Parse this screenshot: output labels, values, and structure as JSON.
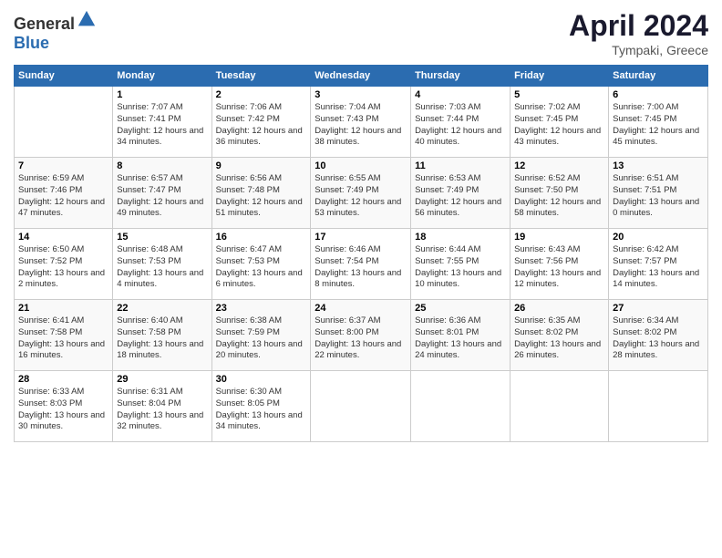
{
  "header": {
    "logo_general": "General",
    "logo_blue": "Blue",
    "title": "April 2024",
    "location": "Tympaki, Greece"
  },
  "columns": [
    "Sunday",
    "Monday",
    "Tuesday",
    "Wednesday",
    "Thursday",
    "Friday",
    "Saturday"
  ],
  "weeks": [
    [
      {
        "day": "",
        "sunrise": "",
        "sunset": "",
        "daylight": ""
      },
      {
        "day": "1",
        "sunrise": "Sunrise: 7:07 AM",
        "sunset": "Sunset: 7:41 PM",
        "daylight": "Daylight: 12 hours and 34 minutes."
      },
      {
        "day": "2",
        "sunrise": "Sunrise: 7:06 AM",
        "sunset": "Sunset: 7:42 PM",
        "daylight": "Daylight: 12 hours and 36 minutes."
      },
      {
        "day": "3",
        "sunrise": "Sunrise: 7:04 AM",
        "sunset": "Sunset: 7:43 PM",
        "daylight": "Daylight: 12 hours and 38 minutes."
      },
      {
        "day": "4",
        "sunrise": "Sunrise: 7:03 AM",
        "sunset": "Sunset: 7:44 PM",
        "daylight": "Daylight: 12 hours and 40 minutes."
      },
      {
        "day": "5",
        "sunrise": "Sunrise: 7:02 AM",
        "sunset": "Sunset: 7:45 PM",
        "daylight": "Daylight: 12 hours and 43 minutes."
      },
      {
        "day": "6",
        "sunrise": "Sunrise: 7:00 AM",
        "sunset": "Sunset: 7:45 PM",
        "daylight": "Daylight: 12 hours and 45 minutes."
      }
    ],
    [
      {
        "day": "7",
        "sunrise": "Sunrise: 6:59 AM",
        "sunset": "Sunset: 7:46 PM",
        "daylight": "Daylight: 12 hours and 47 minutes."
      },
      {
        "day": "8",
        "sunrise": "Sunrise: 6:57 AM",
        "sunset": "Sunset: 7:47 PM",
        "daylight": "Daylight: 12 hours and 49 minutes."
      },
      {
        "day": "9",
        "sunrise": "Sunrise: 6:56 AM",
        "sunset": "Sunset: 7:48 PM",
        "daylight": "Daylight: 12 hours and 51 minutes."
      },
      {
        "day": "10",
        "sunrise": "Sunrise: 6:55 AM",
        "sunset": "Sunset: 7:49 PM",
        "daylight": "Daylight: 12 hours and 53 minutes."
      },
      {
        "day": "11",
        "sunrise": "Sunrise: 6:53 AM",
        "sunset": "Sunset: 7:49 PM",
        "daylight": "Daylight: 12 hours and 56 minutes."
      },
      {
        "day": "12",
        "sunrise": "Sunrise: 6:52 AM",
        "sunset": "Sunset: 7:50 PM",
        "daylight": "Daylight: 12 hours and 58 minutes."
      },
      {
        "day": "13",
        "sunrise": "Sunrise: 6:51 AM",
        "sunset": "Sunset: 7:51 PM",
        "daylight": "Daylight: 13 hours and 0 minutes."
      }
    ],
    [
      {
        "day": "14",
        "sunrise": "Sunrise: 6:50 AM",
        "sunset": "Sunset: 7:52 PM",
        "daylight": "Daylight: 13 hours and 2 minutes."
      },
      {
        "day": "15",
        "sunrise": "Sunrise: 6:48 AM",
        "sunset": "Sunset: 7:53 PM",
        "daylight": "Daylight: 13 hours and 4 minutes."
      },
      {
        "day": "16",
        "sunrise": "Sunrise: 6:47 AM",
        "sunset": "Sunset: 7:53 PM",
        "daylight": "Daylight: 13 hours and 6 minutes."
      },
      {
        "day": "17",
        "sunrise": "Sunrise: 6:46 AM",
        "sunset": "Sunset: 7:54 PM",
        "daylight": "Daylight: 13 hours and 8 minutes."
      },
      {
        "day": "18",
        "sunrise": "Sunrise: 6:44 AM",
        "sunset": "Sunset: 7:55 PM",
        "daylight": "Daylight: 13 hours and 10 minutes."
      },
      {
        "day": "19",
        "sunrise": "Sunrise: 6:43 AM",
        "sunset": "Sunset: 7:56 PM",
        "daylight": "Daylight: 13 hours and 12 minutes."
      },
      {
        "day": "20",
        "sunrise": "Sunrise: 6:42 AM",
        "sunset": "Sunset: 7:57 PM",
        "daylight": "Daylight: 13 hours and 14 minutes."
      }
    ],
    [
      {
        "day": "21",
        "sunrise": "Sunrise: 6:41 AM",
        "sunset": "Sunset: 7:58 PM",
        "daylight": "Daylight: 13 hours and 16 minutes."
      },
      {
        "day": "22",
        "sunrise": "Sunrise: 6:40 AM",
        "sunset": "Sunset: 7:58 PM",
        "daylight": "Daylight: 13 hours and 18 minutes."
      },
      {
        "day": "23",
        "sunrise": "Sunrise: 6:38 AM",
        "sunset": "Sunset: 7:59 PM",
        "daylight": "Daylight: 13 hours and 20 minutes."
      },
      {
        "day": "24",
        "sunrise": "Sunrise: 6:37 AM",
        "sunset": "Sunset: 8:00 PM",
        "daylight": "Daylight: 13 hours and 22 minutes."
      },
      {
        "day": "25",
        "sunrise": "Sunrise: 6:36 AM",
        "sunset": "Sunset: 8:01 PM",
        "daylight": "Daylight: 13 hours and 24 minutes."
      },
      {
        "day": "26",
        "sunrise": "Sunrise: 6:35 AM",
        "sunset": "Sunset: 8:02 PM",
        "daylight": "Daylight: 13 hours and 26 minutes."
      },
      {
        "day": "27",
        "sunrise": "Sunrise: 6:34 AM",
        "sunset": "Sunset: 8:02 PM",
        "daylight": "Daylight: 13 hours and 28 minutes."
      }
    ],
    [
      {
        "day": "28",
        "sunrise": "Sunrise: 6:33 AM",
        "sunset": "Sunset: 8:03 PM",
        "daylight": "Daylight: 13 hours and 30 minutes."
      },
      {
        "day": "29",
        "sunrise": "Sunrise: 6:31 AM",
        "sunset": "Sunset: 8:04 PM",
        "daylight": "Daylight: 13 hours and 32 minutes."
      },
      {
        "day": "30",
        "sunrise": "Sunrise: 6:30 AM",
        "sunset": "Sunset: 8:05 PM",
        "daylight": "Daylight: 13 hours and 34 minutes."
      },
      {
        "day": "",
        "sunrise": "",
        "sunset": "",
        "daylight": ""
      },
      {
        "day": "",
        "sunrise": "",
        "sunset": "",
        "daylight": ""
      },
      {
        "day": "",
        "sunrise": "",
        "sunset": "",
        "daylight": ""
      },
      {
        "day": "",
        "sunrise": "",
        "sunset": "",
        "daylight": ""
      }
    ]
  ]
}
